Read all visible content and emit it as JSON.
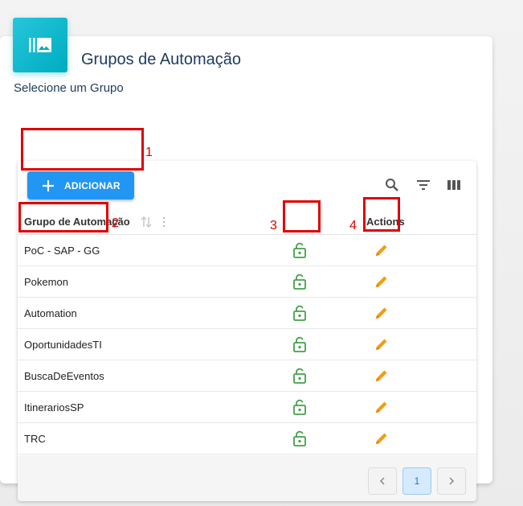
{
  "colors": {
    "accent": "#2196f3",
    "icon_bg": "#00acc1",
    "lock": "#43a047",
    "edit": "#f39c12",
    "annotation": "#e00000",
    "title": "#1f3a5c"
  },
  "card": {
    "icon": "image-library-icon",
    "title": "Grupos de Automação",
    "subtitle": "Selecione um Grupo"
  },
  "toolbar": {
    "add_label": "ADICIONAR",
    "icons": [
      "search-icon",
      "filter-icon",
      "columns-icon"
    ]
  },
  "table": {
    "columns": {
      "name": "Grupo de Automação",
      "actions": "Actions"
    },
    "rows": [
      {
        "name": "PoC - SAP - GG"
      },
      {
        "name": "Pokemon"
      },
      {
        "name": "Automation"
      },
      {
        "name": "OportunidadesTI"
      },
      {
        "name": "BuscaDeEventos"
      },
      {
        "name": "ItinerariosSP"
      },
      {
        "name": "TRC"
      }
    ]
  },
  "pagination": {
    "current_page": "1"
  },
  "annotations": [
    "1",
    "2",
    "3",
    "4"
  ]
}
